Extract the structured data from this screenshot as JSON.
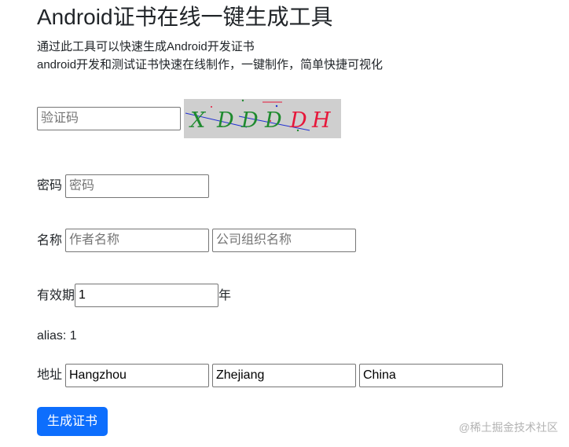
{
  "header": {
    "title": "Android证书在线一键生成工具",
    "desc1": "通过此工具可以快速生成Android开发证书",
    "desc2": "android开发和测试证书快速在线制作，一键制作，简单快捷可视化"
  },
  "form": {
    "captcha": {
      "placeholder": "验证码",
      "value": "",
      "image_text": "XDDDDH"
    },
    "password": {
      "label": "密码",
      "placeholder": "密码",
      "value": ""
    },
    "name": {
      "label": "名称",
      "author_placeholder": "作者名称",
      "org_placeholder": "公司组织名称"
    },
    "validity": {
      "label": "有效期",
      "value": "1",
      "unit": "年"
    },
    "alias": {
      "text": "alias: 1"
    },
    "address": {
      "label": "地址",
      "city": "Hangzhou",
      "province": "Zhejiang",
      "country": "China"
    },
    "submit_label": "生成证书"
  },
  "watermark": "@稀土掘金技术社区",
  "colors": {
    "button": "#0d6efd",
    "captcha_bg": "#cfcfcf",
    "captcha_text_green": "#1e8a2e",
    "captcha_text_red": "#e6173a"
  }
}
